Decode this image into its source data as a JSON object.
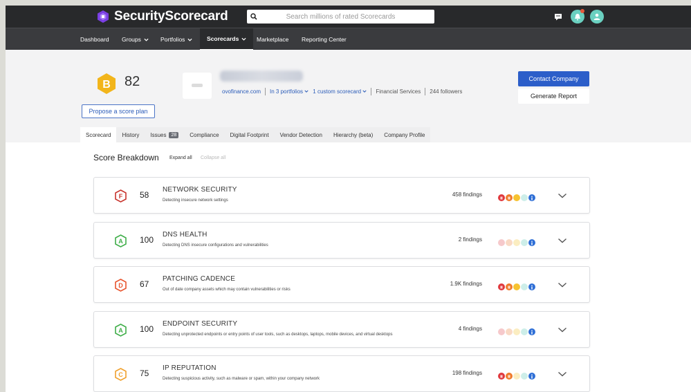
{
  "app": {
    "name": "SecurityScorecard"
  },
  "search": {
    "placeholder": "Search millions of rated Scorecards"
  },
  "nav": {
    "items": [
      {
        "label": "Dashboard",
        "has_dropdown": false
      },
      {
        "label": "Groups",
        "has_dropdown": true
      },
      {
        "label": "Portfolios",
        "has_dropdown": true
      },
      {
        "label": "Scorecards",
        "has_dropdown": true,
        "active": true
      },
      {
        "label": "Marketplace",
        "has_dropdown": false
      },
      {
        "label": "Reporting Center",
        "has_dropdown": false
      }
    ]
  },
  "company": {
    "grade": "B",
    "score": "82",
    "grade_color": "#f2b51b",
    "propose_label": "Propose a score plan",
    "domain": "ovofinance.com",
    "portfolios": "In 3 portfolios",
    "custom_scorecard": "1 custom scorecard",
    "industry": "Financial Services",
    "followers": "244 followers",
    "contact_label": "Contact Company",
    "report_label": "Generate Report"
  },
  "tabs": [
    {
      "label": "Scorecard",
      "active": true
    },
    {
      "label": "History"
    },
    {
      "label": "Issues",
      "badge": "28"
    },
    {
      "label": "Compliance"
    },
    {
      "label": "Digital Footprint"
    },
    {
      "label": "Vendor Detection"
    },
    {
      "label": "Hierarchy (beta)"
    },
    {
      "label": "Company Profile"
    }
  ],
  "breakdown": {
    "title": "Score Breakdown",
    "expand_all": "Expand all",
    "collapse_all": "Collapse all",
    "factors": [
      {
        "grade": "F",
        "color": "#c8342d",
        "score": "58",
        "name": "NETWORK SECURITY",
        "description": "Detecting insecure network settings",
        "findings": "458 findings",
        "severity_active": [
          true,
          true,
          true,
          false,
          true
        ]
      },
      {
        "grade": "A",
        "color": "#3fae49",
        "score": "100",
        "name": "DNS HEALTH",
        "description": "Detecting DNS insecure configurations and vulnerabilities",
        "findings": "2 findings",
        "severity_active": [
          false,
          false,
          false,
          false,
          true
        ]
      },
      {
        "grade": "D",
        "color": "#e8542e",
        "score": "67",
        "name": "PATCHING CADENCE",
        "description": "Out of date company assets which may contain vulnerabilities or risks",
        "findings": "1.9K findings",
        "severity_active": [
          true,
          true,
          true,
          false,
          true
        ]
      },
      {
        "grade": "A",
        "color": "#3fae49",
        "score": "100",
        "name": "ENDPOINT SECURITY",
        "description": "Detecting unprotected endpoints or entry points of user tools, such as desktops, laptops, mobile devices, and virtual desktops",
        "findings": "4 findings",
        "severity_active": [
          false,
          false,
          false,
          false,
          true
        ]
      },
      {
        "grade": "C",
        "color": "#f0a02c",
        "score": "75",
        "name": "IP REPUTATION",
        "description": "Detecting suspicious activity, such as malware or spam, within your company network",
        "findings": "198 findings",
        "severity_active": [
          true,
          true,
          false,
          false,
          true
        ]
      }
    ]
  },
  "severity_colors": {
    "active": [
      "#e0393e",
      "#ef7a2a",
      "#f6c230",
      "#6fd0c6",
      "#2f6fd6"
    ],
    "inactive": [
      "#f6c9cb",
      "#f9d9c4",
      "#fbedc1",
      "#cdeee9",
      "#2f6fd6"
    ]
  }
}
